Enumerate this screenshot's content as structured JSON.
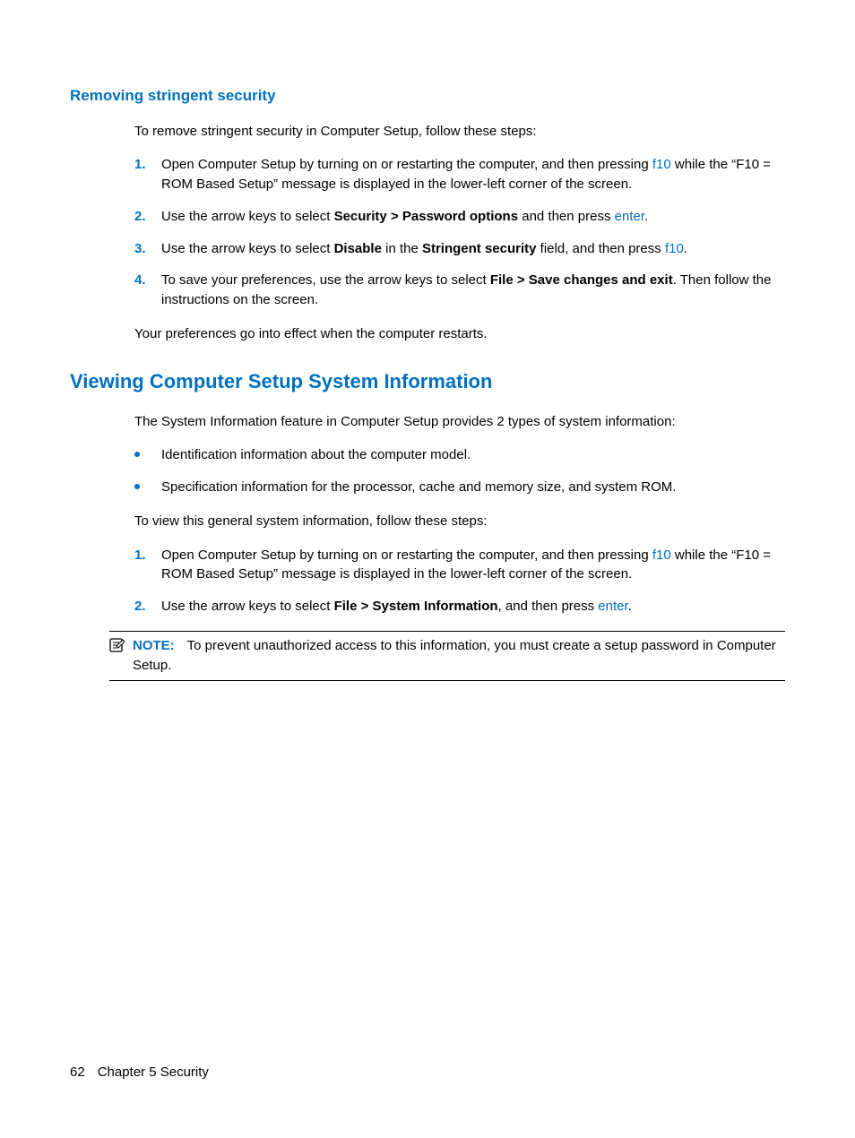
{
  "section1": {
    "heading": "Removing stringent security",
    "intro": "To remove stringent security in Computer Setup, follow these steps:",
    "steps": [
      {
        "num": "1.",
        "pre": "Open Computer Setup by turning on or restarting the computer, and then pressing ",
        "key": "f10",
        "post": " while the “F10 = ROM Based Setup” message is displayed in the lower-left corner of the screen."
      },
      {
        "num": "2.",
        "pre": "Use the arrow keys to select ",
        "bold": "Security > Password options",
        "mid": " and then press ",
        "key": "enter",
        "post": "."
      },
      {
        "num": "3.",
        "pre": "Use the arrow keys to select ",
        "bold1": "Disable",
        "mid1": " in the ",
        "bold2": "Stringent security",
        "mid2": " field, and then press ",
        "key": "f10",
        "post": "."
      },
      {
        "num": "4.",
        "pre": "To save your preferences, use the arrow keys to select ",
        "bold": "File > Save changes and exit",
        "post": ". Then follow the instructions on the screen."
      }
    ],
    "outro": "Your preferences go into effect when the computer restarts."
  },
  "section2": {
    "heading": "Viewing Computer Setup System Information",
    "intro": "The System Information feature in Computer Setup provides 2 types of system information:",
    "bullets": [
      "Identification information about the computer model.",
      "Specification information for the processor, cache and memory size, and system ROM."
    ],
    "intro2": "To view this general system information, follow these steps:",
    "steps": [
      {
        "num": "1.",
        "pre": "Open Computer Setup by turning on or restarting the computer, and then pressing ",
        "key": "f10",
        "post": " while the “F10 = ROM Based Setup” message is displayed in the lower-left corner of the screen."
      },
      {
        "num": "2.",
        "pre": "Use the arrow keys to select ",
        "bold": "File > System Information",
        "mid": ", and then press ",
        "key": "enter",
        "post": "."
      }
    ],
    "note": {
      "label": "NOTE:",
      "text": "To prevent unauthorized access to this information, you must create a setup password in Computer Setup."
    }
  },
  "footer": {
    "page": "62",
    "chapter": "Chapter 5   Security"
  }
}
